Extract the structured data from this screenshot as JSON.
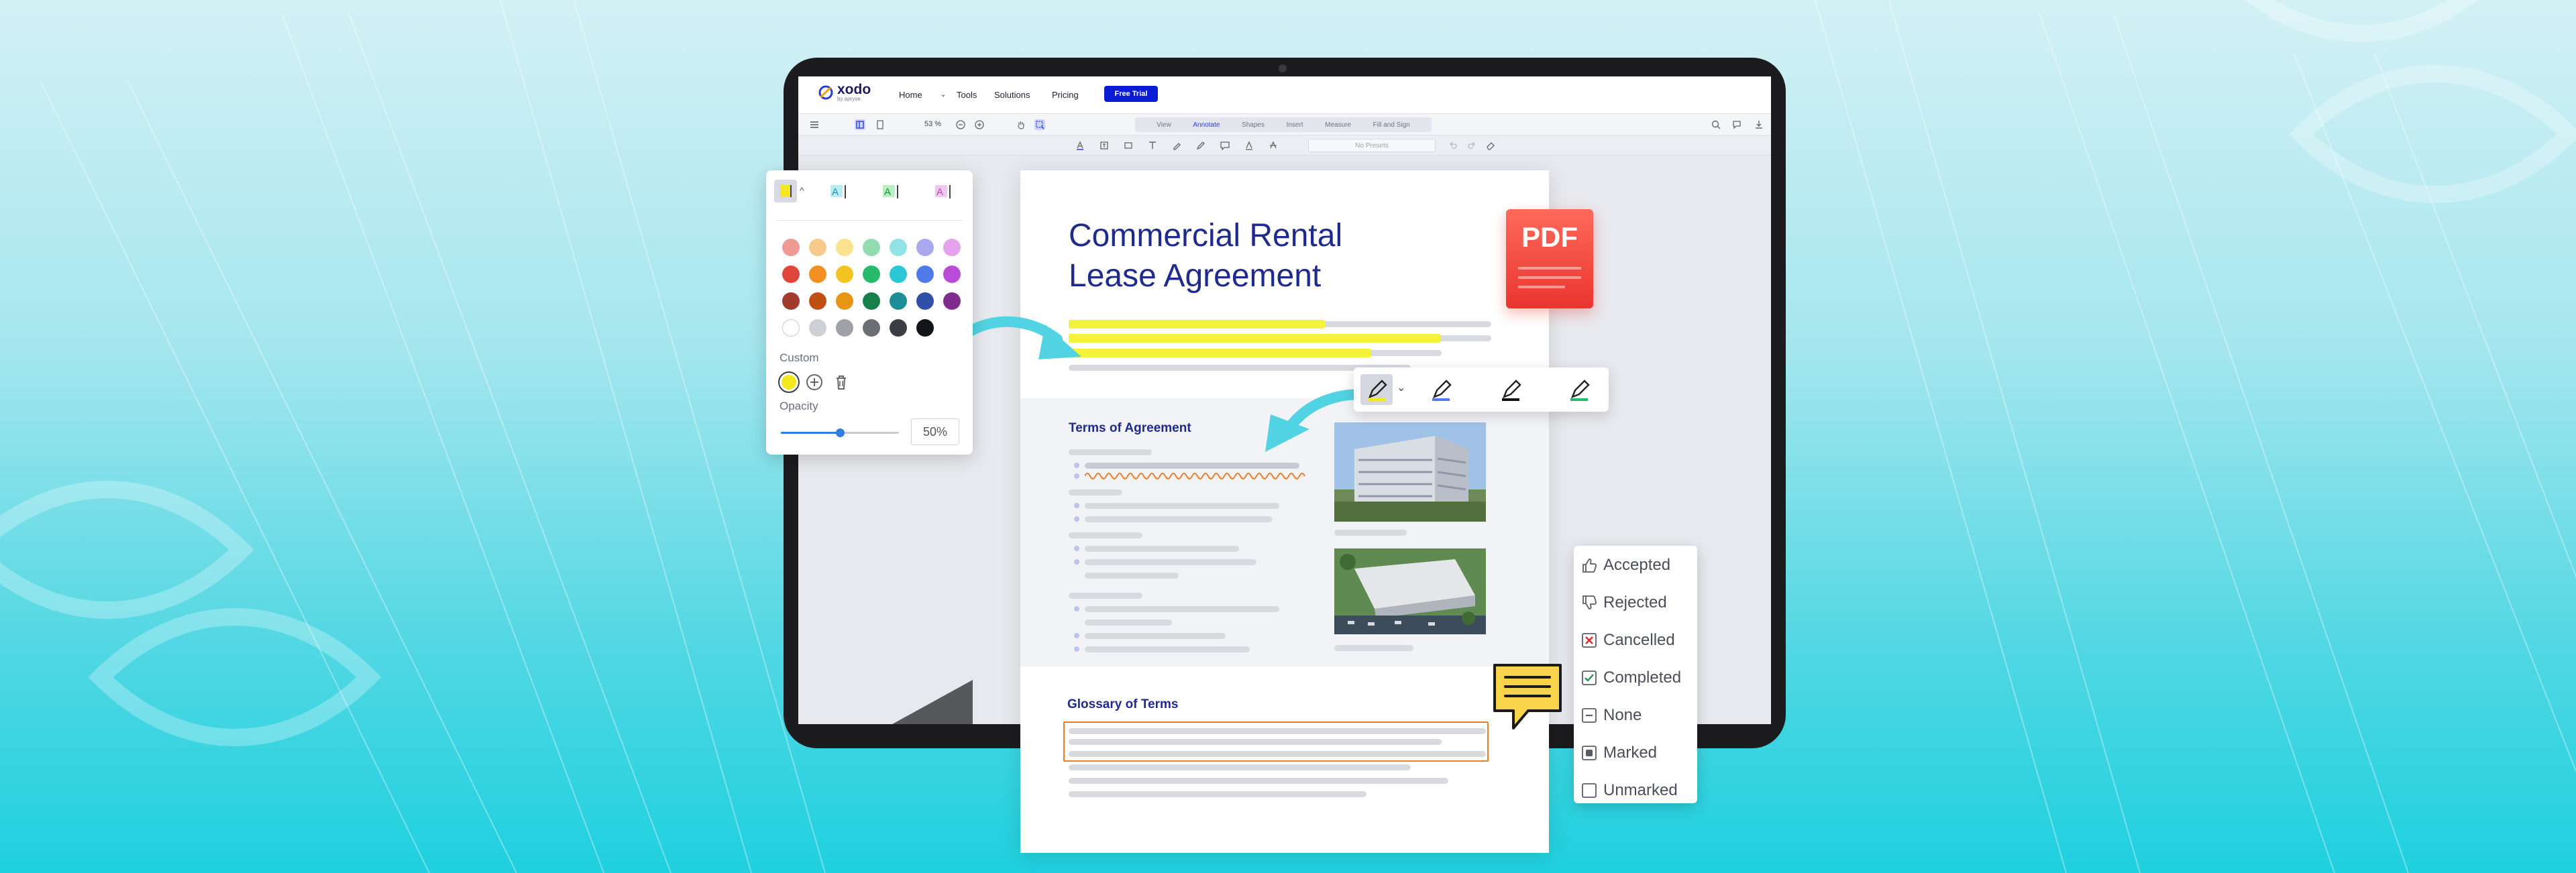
{
  "app": {
    "logo_text": "xodo",
    "logo_sub": "by apryse",
    "nav": [
      {
        "label": "Home"
      },
      {
        "label": "Tools"
      },
      {
        "label": "Solutions"
      },
      {
        "label": "Pricing"
      }
    ],
    "trial_button": "Free Trial"
  },
  "toolbar": {
    "zoom": "53 %",
    "tabs": [
      "View",
      "Annotate",
      "Shapes",
      "Insert",
      "Measure",
      "Fill and Sign"
    ],
    "active_tab": "Annotate",
    "preset_placeholder": "No Presets"
  },
  "document": {
    "title_line1": "Commercial Rental",
    "title_line2": "Lease Agreement",
    "section1": "Terms of Agreement",
    "section2": "Glossary of Terms",
    "badge": "PDF"
  },
  "color_panel": {
    "custom_label": "Custom",
    "opacity_label": "Opacity",
    "opacity_value": "50%",
    "opacity_fraction": 0.5,
    "selected_color": "#f3e81c",
    "palette": [
      [
        "#f09a93",
        "#f7c98a",
        "#fbe28c",
        "#93dcb0",
        "#91e2e6",
        "#a9a8ee",
        "#e4a3ec"
      ],
      [
        "#e0463c",
        "#f39023",
        "#f5c322",
        "#28ba6b",
        "#2bc7d6",
        "#4f7ae8",
        "#b94bd8"
      ],
      [
        "#a23a2e",
        "#c14f14",
        "#e89516",
        "#17804a",
        "#1b8f95",
        "#2f4fa8",
        "#822b8e"
      ],
      [
        "#ffffff",
        "#cfd0d5",
        "#9fa1a8",
        "#6c6e75",
        "#3c3e45",
        "#141518"
      ]
    ]
  },
  "status_list": [
    {
      "label": "Accepted",
      "icon": "thumbs-up-icon"
    },
    {
      "label": "Rejected",
      "icon": "thumbs-down-icon"
    },
    {
      "label": "Cancelled",
      "icon": "cancelled-icon"
    },
    {
      "label": "Completed",
      "icon": "completed-icon"
    },
    {
      "label": "None",
      "icon": "none-icon"
    },
    {
      "label": "Marked",
      "icon": "marked-icon"
    },
    {
      "label": "Unmarked",
      "icon": "unmarked-icon"
    }
  ],
  "colors": {
    "brand": "#0a1bd6",
    "title": "#1f2a8f",
    "highlight": "#f4f23a",
    "accent_orange": "#ee7d2a",
    "chat": "#f9d34a"
  }
}
